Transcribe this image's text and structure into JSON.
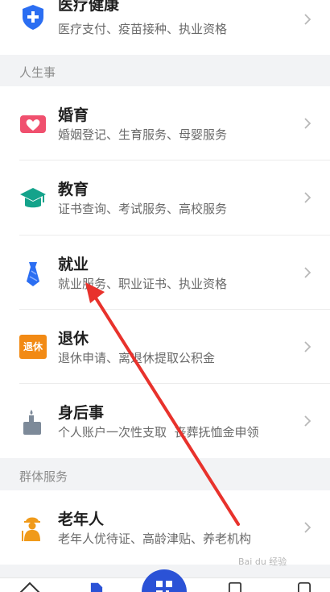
{
  "rows": [
    {
      "title": "医疗健康",
      "sub": "医疗支付、疫苗接种、执业资格"
    },
    {
      "title": "婚育",
      "sub": "婚姻登记、生育服务、母婴服务"
    },
    {
      "title": "教育",
      "sub": "证书查询、考试服务、高校服务"
    },
    {
      "title": "就业",
      "sub": "就业服务、职业证书、执业资格"
    },
    {
      "title": "退休",
      "sub": "退休申请、离退休提取公积金",
      "icon_text": "退休"
    },
    {
      "title": "身后事",
      "sub": "个人账户一次性支取  丧葬抚恤金申领"
    },
    {
      "title": "老年人",
      "sub": "老年人优待证、高龄津贴、养老机构"
    }
  ],
  "sections": {
    "life": "人生事",
    "group": "群体服务"
  },
  "colors": {
    "accent_blue": "#2b6ef2",
    "marriage_red": "#f0506e",
    "education_teal": "#14a38b",
    "retire_orange": "#f28a14",
    "elder_orange": "#f09a1a",
    "arrow_red": "#e8322c"
  },
  "icons": [
    "medical-shield-icon",
    "heart-icon",
    "graduation-cap-icon",
    "tie-icon",
    "retire-badge-icon",
    "memorial-candle-icon",
    "elder-person-icon",
    "chevron-right-icon"
  ],
  "watermark": "Bai du 经验"
}
